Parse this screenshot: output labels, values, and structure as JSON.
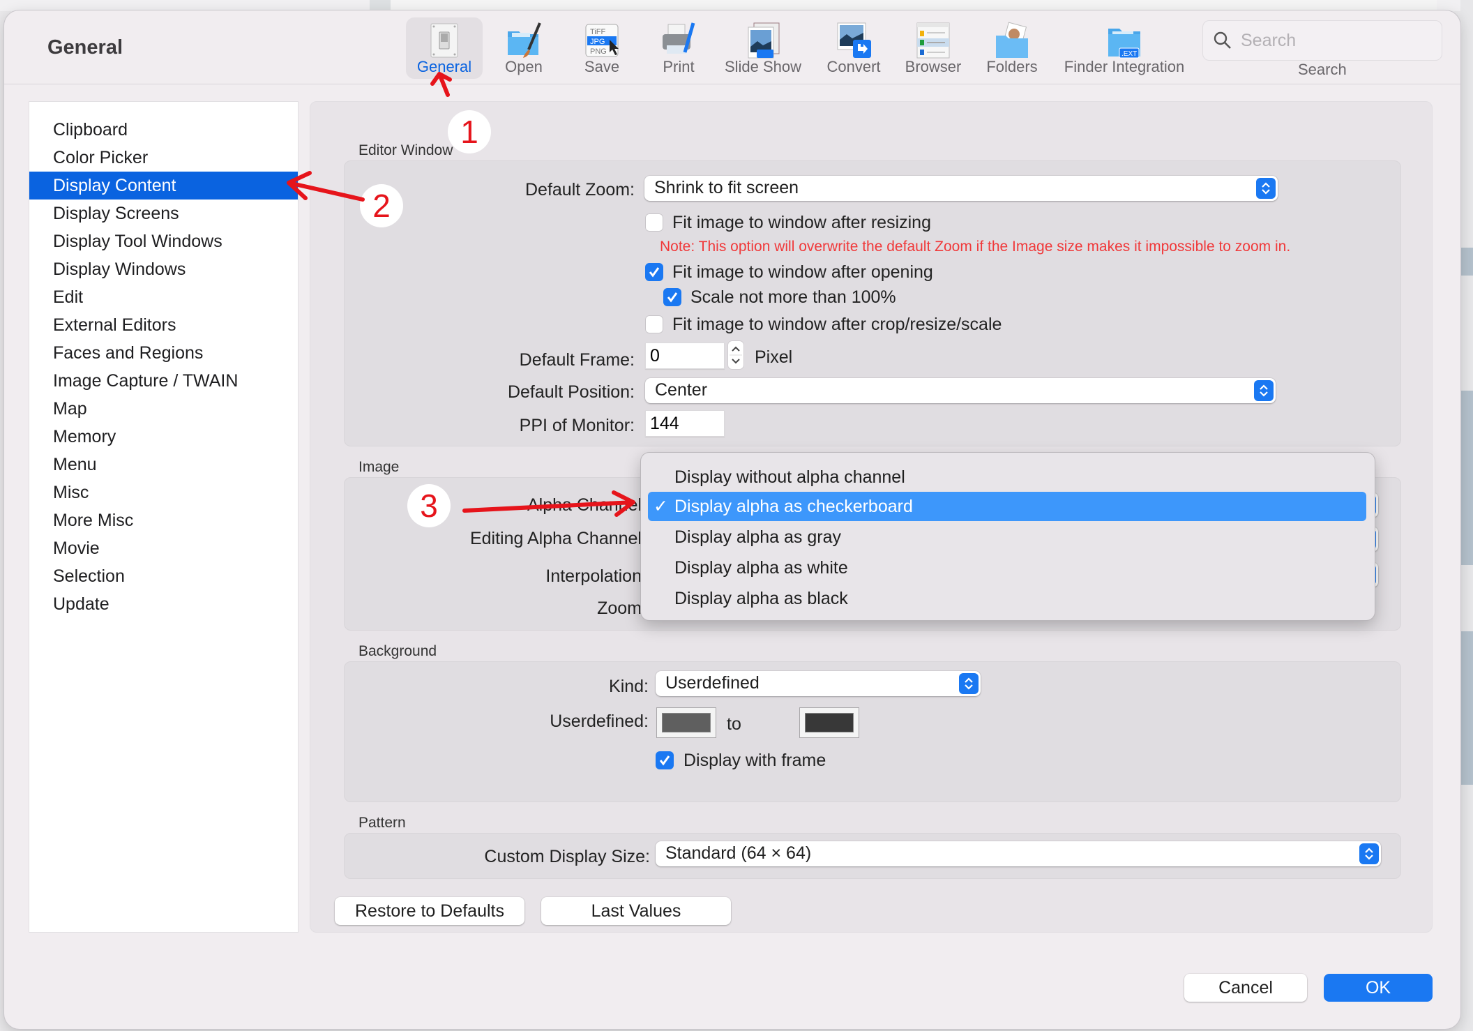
{
  "window": {
    "title": "General"
  },
  "toolbar": {
    "items": [
      {
        "label": "General",
        "icon": "light-switch-icon",
        "active": true
      },
      {
        "label": "Open",
        "icon": "folder-brush-icon"
      },
      {
        "label": "Save",
        "icon": "file-formats-icon"
      },
      {
        "label": "Print",
        "icon": "printer-icon"
      },
      {
        "label": "Slide Show",
        "icon": "slideshow-icon"
      },
      {
        "label": "Convert",
        "icon": "convert-icon"
      },
      {
        "label": "Browser",
        "icon": "browser-icon"
      },
      {
        "label": "Folders",
        "icon": "folder-photo-icon"
      },
      {
        "label": "Finder Integration",
        "icon": "folder-ext-icon"
      }
    ],
    "search": {
      "placeholder": "Search",
      "caption": "Search"
    }
  },
  "sidebar": {
    "items": [
      {
        "label": "Clipboard"
      },
      {
        "label": "Color Picker"
      },
      {
        "label": "Display Content",
        "selected": true
      },
      {
        "label": "Display Screens"
      },
      {
        "label": "Display Tool Windows"
      },
      {
        "label": "Display Windows"
      },
      {
        "label": "Edit"
      },
      {
        "label": "External Editors"
      },
      {
        "label": "Faces and Regions"
      },
      {
        "label": "Image Capture / TWAIN"
      },
      {
        "label": "Map"
      },
      {
        "label": "Memory"
      },
      {
        "label": "Menu"
      },
      {
        "label": "Misc"
      },
      {
        "label": "More Misc"
      },
      {
        "label": "Movie"
      },
      {
        "label": "Selection"
      },
      {
        "label": "Update"
      }
    ]
  },
  "editor_window": {
    "title": "Editor Window",
    "default_zoom": {
      "label": "Default Zoom:",
      "value": "Shrink to fit screen"
    },
    "fit_after_resizing": {
      "label": "Fit image to window after resizing",
      "checked": false
    },
    "note": "Note: This option will overwrite the default Zoom if the Image size makes it impossible to zoom in.",
    "fit_after_opening": {
      "label": "Fit image to window after opening",
      "checked": true
    },
    "scale_not_more": {
      "label": "Scale not more than 100%",
      "checked": true
    },
    "fit_after_crop": {
      "label": "Fit image to window after crop/resize/scale",
      "checked": false
    },
    "default_frame": {
      "label": "Default Frame:",
      "value": "0",
      "unit": "Pixel"
    },
    "default_position": {
      "label": "Default Position:",
      "value": "Center"
    },
    "ppi": {
      "label": "PPI of Monitor:",
      "value": "144"
    }
  },
  "image": {
    "title": "Image",
    "alpha_channel": {
      "label": "Alpha Channel"
    },
    "editing_alpha_channel": {
      "label": "Editing Alpha Channel"
    },
    "interpolation": {
      "label": "Interpolation"
    },
    "zoom": {
      "label": "Zoom"
    },
    "alpha_menu": {
      "options": [
        {
          "label": "Display without alpha channel"
        },
        {
          "label": "Display alpha as checkerboard",
          "selected": true
        },
        {
          "label": "Display alpha as gray"
        },
        {
          "label": "Display alpha as white"
        },
        {
          "label": "Display alpha as black"
        }
      ],
      "check_glyph": "✓"
    }
  },
  "background": {
    "title": "Background",
    "kind": {
      "label": "Kind:",
      "value": "Userdefined"
    },
    "userdefined": {
      "label": "Userdefined:",
      "to": "to",
      "color_from": "#5f5f5f",
      "color_to": "#383838"
    },
    "display_with_frame": {
      "label": "Display with frame",
      "checked": true
    }
  },
  "pattern": {
    "title": "Pattern",
    "custom_display_size": {
      "label": "Custom Display Size:",
      "value": "Standard (64 × 64)"
    }
  },
  "buttons": {
    "restore": "Restore to Defaults",
    "last_values": "Last Values",
    "cancel": "Cancel",
    "ok": "OK"
  },
  "annotations": {
    "n1": "1",
    "n2": "2",
    "n3": "3"
  },
  "colors": {
    "accent": "#1a78f2",
    "selection": "#0a63e0",
    "menu_highlight": "#3d97fb",
    "note": "#f0393a",
    "annotation": "#e6141b"
  }
}
